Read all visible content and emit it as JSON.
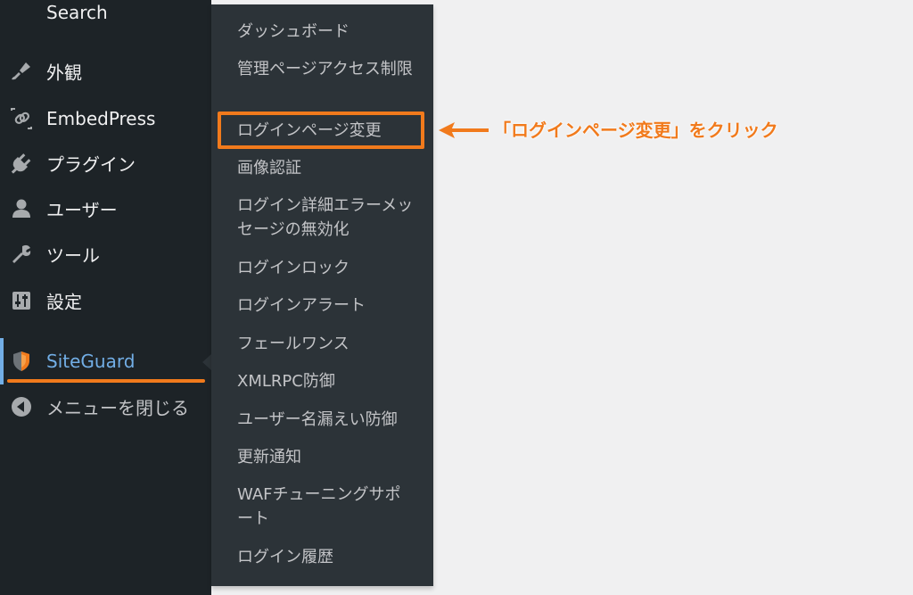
{
  "sidebar": {
    "search_label": "Search",
    "items": [
      {
        "label": "外観",
        "icon": "paintbrush-icon"
      },
      {
        "label": "EmbedPress",
        "icon": "embedpress-icon"
      },
      {
        "label": "プラグイン",
        "icon": "plugin-icon"
      },
      {
        "label": "ユーザー",
        "icon": "user-icon"
      },
      {
        "label": "ツール",
        "icon": "wrench-icon"
      },
      {
        "label": "設定",
        "icon": "settings-sliders-icon"
      }
    ],
    "current": {
      "label": "SiteGuard",
      "icon": "siteguard-shield-icon"
    },
    "collapse_label": "メニューを閉じる"
  },
  "submenu": {
    "items": [
      "ダッシュボード",
      "管理ページアクセス制限",
      "ログインページ変更",
      "画像認証",
      "ログイン詳細エラーメッセージの無効化",
      "ログインロック",
      "ログインアラート",
      "フェールワンス",
      "XMLRPC防御",
      "ユーザー名漏えい防御",
      "更新通知",
      "WAFチューニングサポート",
      "ログイン履歴"
    ]
  },
  "annotation": {
    "callout_text": "「ログインページ変更」をクリック",
    "highlight_color": "#f17a1c"
  },
  "colors": {
    "sidebar_bg": "#1d2327",
    "submenu_bg": "#2c3338",
    "current_text": "#72aee6",
    "annotation": "#f17a1c"
  }
}
